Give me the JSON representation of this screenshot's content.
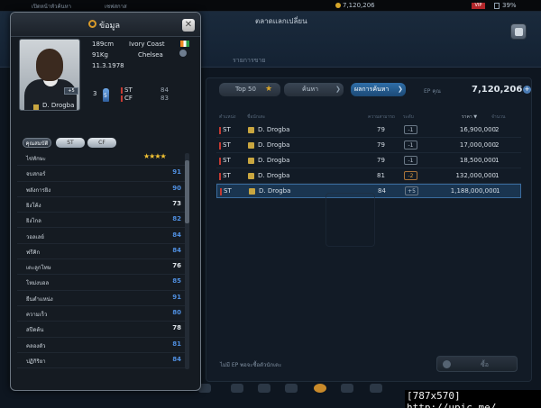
{
  "topbar": {
    "left_tab": "เปิดหน้าหัวค้นหา",
    "second_tab": "เซฟสกาส",
    "coins": "7,120,206",
    "vip": "VIP",
    "battery": "39%"
  },
  "header": {
    "title": "ตลาดแลกเปลี่ยน",
    "subnav": "รายการขาย"
  },
  "tabs": {
    "top50": "Top 50",
    "search": "ค้นหา",
    "results": "ผลการค้นหา"
  },
  "ep": {
    "label": "EP คุณ",
    "value": "7,120,206"
  },
  "table": {
    "columns": [
      "ตำแหน่ง",
      "ชื่อนักเตะ",
      "ความสามารถ",
      "ระดับ",
      "ราคา ▼",
      "จำนวน"
    ],
    "rows": [
      {
        "pos": "ST",
        "name": "D. Drogba",
        "ovr": "79",
        "trend": "-1",
        "price": "16,900,000",
        "qty": "2"
      },
      {
        "pos": "ST",
        "name": "D. Drogba",
        "ovr": "79",
        "trend": "-1",
        "price": "17,000,000",
        "qty": "2"
      },
      {
        "pos": "ST",
        "name": "D. Drogba",
        "ovr": "79",
        "trend": "-1",
        "price": "18,500,000",
        "qty": "1"
      },
      {
        "pos": "ST",
        "name": "D. Drogba",
        "ovr": "81",
        "trend": "-2",
        "price": "132,000,000",
        "qty": "1"
      },
      {
        "pos": "ST",
        "name": "D. Drogba",
        "ovr": "84",
        "trend": "+5",
        "price": "1,188,000,000",
        "qty": "1"
      }
    ]
  },
  "footer": {
    "note": "ไม่มี EP พอจะซื้อตัวนักเตะ",
    "buy": "ซื้อ"
  },
  "watermark_text": "[787x570] http://upic.me/",
  "modal": {
    "title": "ข้อมูล",
    "close": "✕",
    "player": {
      "name": "D. Drogba",
      "height": "189cm",
      "weight": "91Kg",
      "dob": "11.3.1978",
      "nation": "Ivory Coast",
      "club": "Chelsea",
      "ovr_badge": "+5",
      "foot_left": "3",
      "foot_right": "5",
      "positions": [
        {
          "pos": "ST",
          "val": "84"
        },
        {
          "pos": "CF",
          "val": "83"
        }
      ]
    },
    "stat_tabs": [
      "คุณสมบัติ",
      "ST",
      "CF"
    ],
    "stats": [
      {
        "name": "ไข่ทักษะ",
        "stars": "★★★★",
        "value": "",
        "color": "#f2c233"
      },
      {
        "name": "จบสกอร์",
        "value": "91",
        "color": "#4f8fe0"
      },
      {
        "name": "พลังการยิง",
        "value": "90",
        "color": "#4f8fe0"
      },
      {
        "name": "ยิงโค้ง",
        "value": "73",
        "color": "#dfe5ea"
      },
      {
        "name": "ยิงไกล",
        "value": "82",
        "color": "#4f8fe0"
      },
      {
        "name": "วอลเลย์",
        "value": "84",
        "color": "#4f8fe0"
      },
      {
        "name": "ฟรีคิก",
        "value": "84",
        "color": "#4f8fe0"
      },
      {
        "name": "เตะลูกโทษ",
        "value": "76",
        "color": "#dfe5ea"
      },
      {
        "name": "โหม่งบอล",
        "value": "85",
        "color": "#4f8fe0"
      },
      {
        "name": "ยืนตำแหน่ง",
        "value": "91",
        "color": "#4f8fe0"
      },
      {
        "name": "ความเร็ว",
        "value": "80",
        "color": "#4f8fe0"
      },
      {
        "name": "สปีดต้น",
        "value": "78",
        "color": "#dfe5ea"
      },
      {
        "name": "คลองตัว",
        "value": "81",
        "color": "#4f8fe0"
      },
      {
        "name": "ปฏิกิริยา",
        "value": "84",
        "color": "#4f8fe0"
      }
    ]
  }
}
